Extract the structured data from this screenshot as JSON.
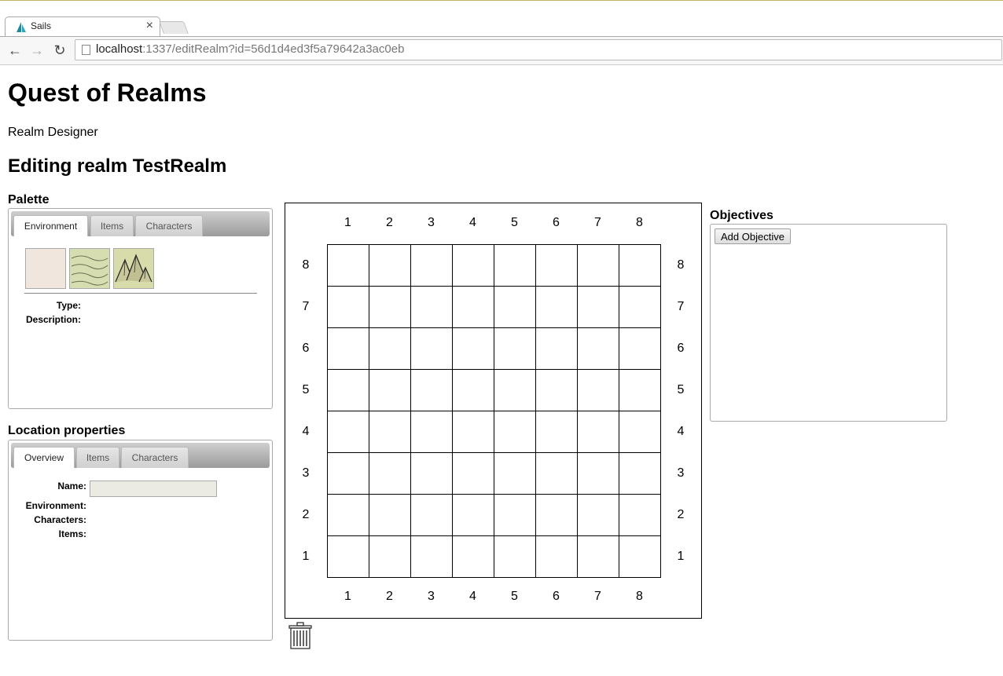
{
  "browser": {
    "tab_title": "Sails",
    "tab_close": "×",
    "url_host": "localhost",
    "url_rest": ":1337/editRealm?id=56d1d4ed3f5a79642a3ac0eb",
    "back_glyph": "←",
    "forward_glyph": "→",
    "reload_glyph": "↻"
  },
  "page": {
    "title": "Quest of Realms",
    "subtitle": "Realm Designer",
    "heading": "Editing realm TestRealm"
  },
  "palette": {
    "heading": "Palette",
    "tabs": [
      "Environment",
      "Items",
      "Characters"
    ],
    "type_label": "Type:",
    "description_label": "Description:",
    "swatch_icons": [
      "plain-tile-icon",
      "grassland-tile-icon",
      "mountain-tile-icon"
    ]
  },
  "location": {
    "heading": "Location properties",
    "tabs": [
      "Overview",
      "Items",
      "Characters"
    ],
    "name_label": "Name:",
    "environment_label": "Environment:",
    "characters_label": "Characters:",
    "items_label": "Items:",
    "name_value": ""
  },
  "map": {
    "columns": [
      "1",
      "2",
      "3",
      "4",
      "5",
      "6",
      "7",
      "8"
    ],
    "rows": [
      "8",
      "7",
      "6",
      "5",
      "4",
      "3",
      "2",
      "1"
    ]
  },
  "objectives": {
    "heading": "Objectives",
    "add_button": "Add Objective"
  },
  "colors": {
    "plain": "#f0e6dd",
    "grassland": "#d6ddb0",
    "mountain": "#d8dcaa"
  }
}
